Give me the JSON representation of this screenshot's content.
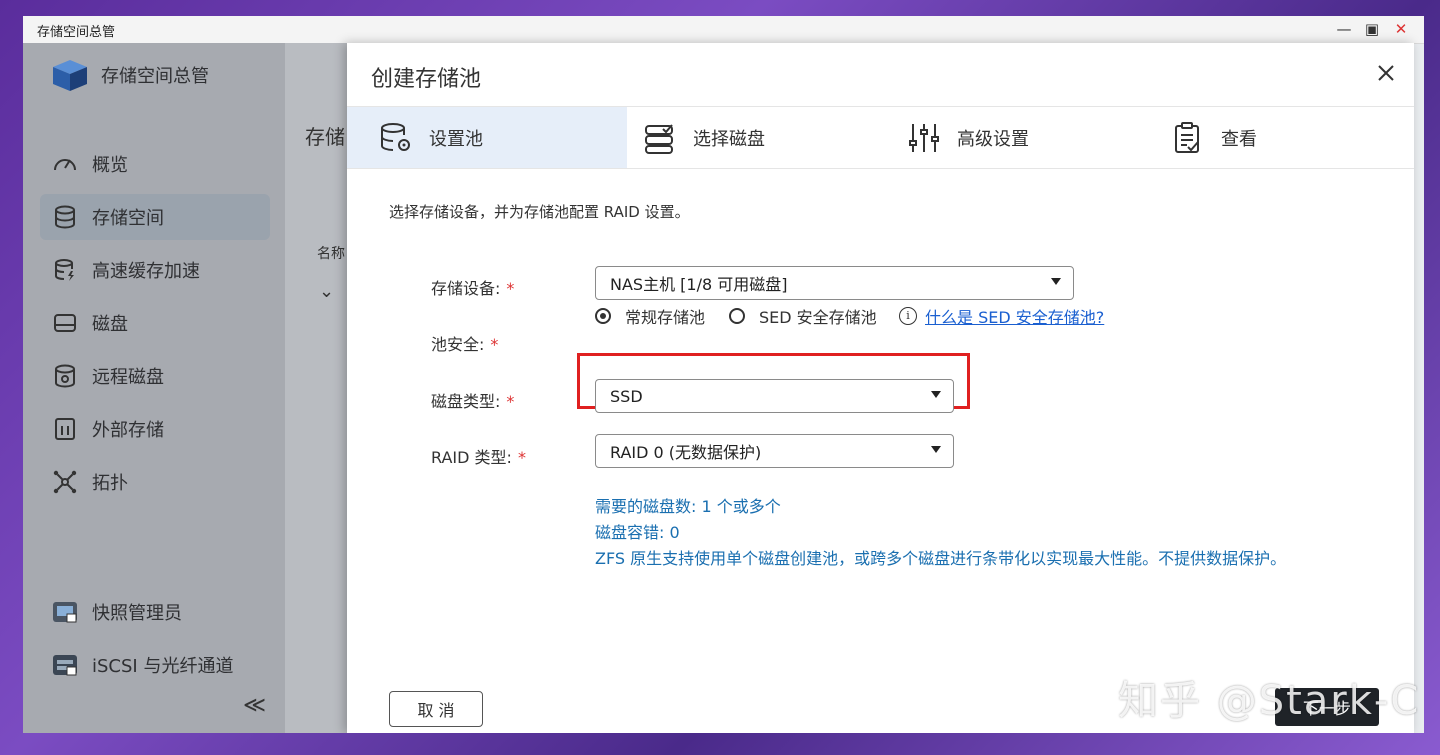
{
  "window": {
    "title": "存储空间总管"
  },
  "sidebar": {
    "app_name": "存储空间总管",
    "items": [
      {
        "label": "概览",
        "icon": "gauge-icon"
      },
      {
        "label": "存储空间",
        "icon": "database-icon",
        "active": true
      },
      {
        "label": "高速缓存加速",
        "icon": "cache-database-icon"
      },
      {
        "label": "磁盘",
        "icon": "disk-icon"
      },
      {
        "label": "远程磁盘",
        "icon": "remote-disk-icon"
      },
      {
        "label": "外部存储",
        "icon": "external-storage-icon"
      },
      {
        "label": "拓扑",
        "icon": "topology-icon"
      }
    ],
    "bottom_items": [
      {
        "label": "快照管理员",
        "icon": "snapshot-app-icon"
      },
      {
        "label": "iSCSI 与光纤通道",
        "icon": "iscsi-app-icon"
      }
    ],
    "collapse_glyph": "≪"
  },
  "background_page": {
    "heading": "存储",
    "column_name": "名称"
  },
  "dialog": {
    "title": "创建存储池",
    "steps": [
      {
        "label": "设置池",
        "icon": "storage-settings-icon",
        "active": true
      },
      {
        "label": "选择磁盘",
        "icon": "select-disk-icon"
      },
      {
        "label": "高级设置",
        "icon": "sliders-icon"
      },
      {
        "label": "查看",
        "icon": "checklist-icon"
      }
    ],
    "intro": "选择存储设备，并为存储池配置 RAID 设置。",
    "fields": {
      "storage_device": {
        "label": "存储设备:",
        "required": "*",
        "value": "NAS主机 [1/8 可用磁盘]"
      },
      "pool_security": {
        "label": "池安全:",
        "required": "*",
        "options": [
          {
            "label": "常规存储池",
            "selected": true
          },
          {
            "label": "SED 安全存储池",
            "selected": false
          }
        ],
        "help_link": "什么是 SED 安全存储池?"
      },
      "disk_type": {
        "label": "磁盘类型:",
        "required": "*",
        "value": "SSD"
      },
      "raid_type": {
        "label": "RAID 类型:",
        "required": "*",
        "value": "RAID 0 (无数据保护)"
      }
    },
    "hints": [
      "需要的磁盘数: 1 个或多个",
      "磁盘容错: 0",
      "ZFS 原生支持使用单个磁盘创建池，或跨多个磁盘进行条带化以实现最大性能。不提供数据保护。"
    ],
    "cancel_label": "取 消",
    "next_label": "下一步"
  },
  "watermark": "知乎 @Stark-C",
  "colors": {
    "accent": "#1a5fd0",
    "hint": "#1a6fb0",
    "highlight": "#e02020",
    "required": "#d33"
  }
}
